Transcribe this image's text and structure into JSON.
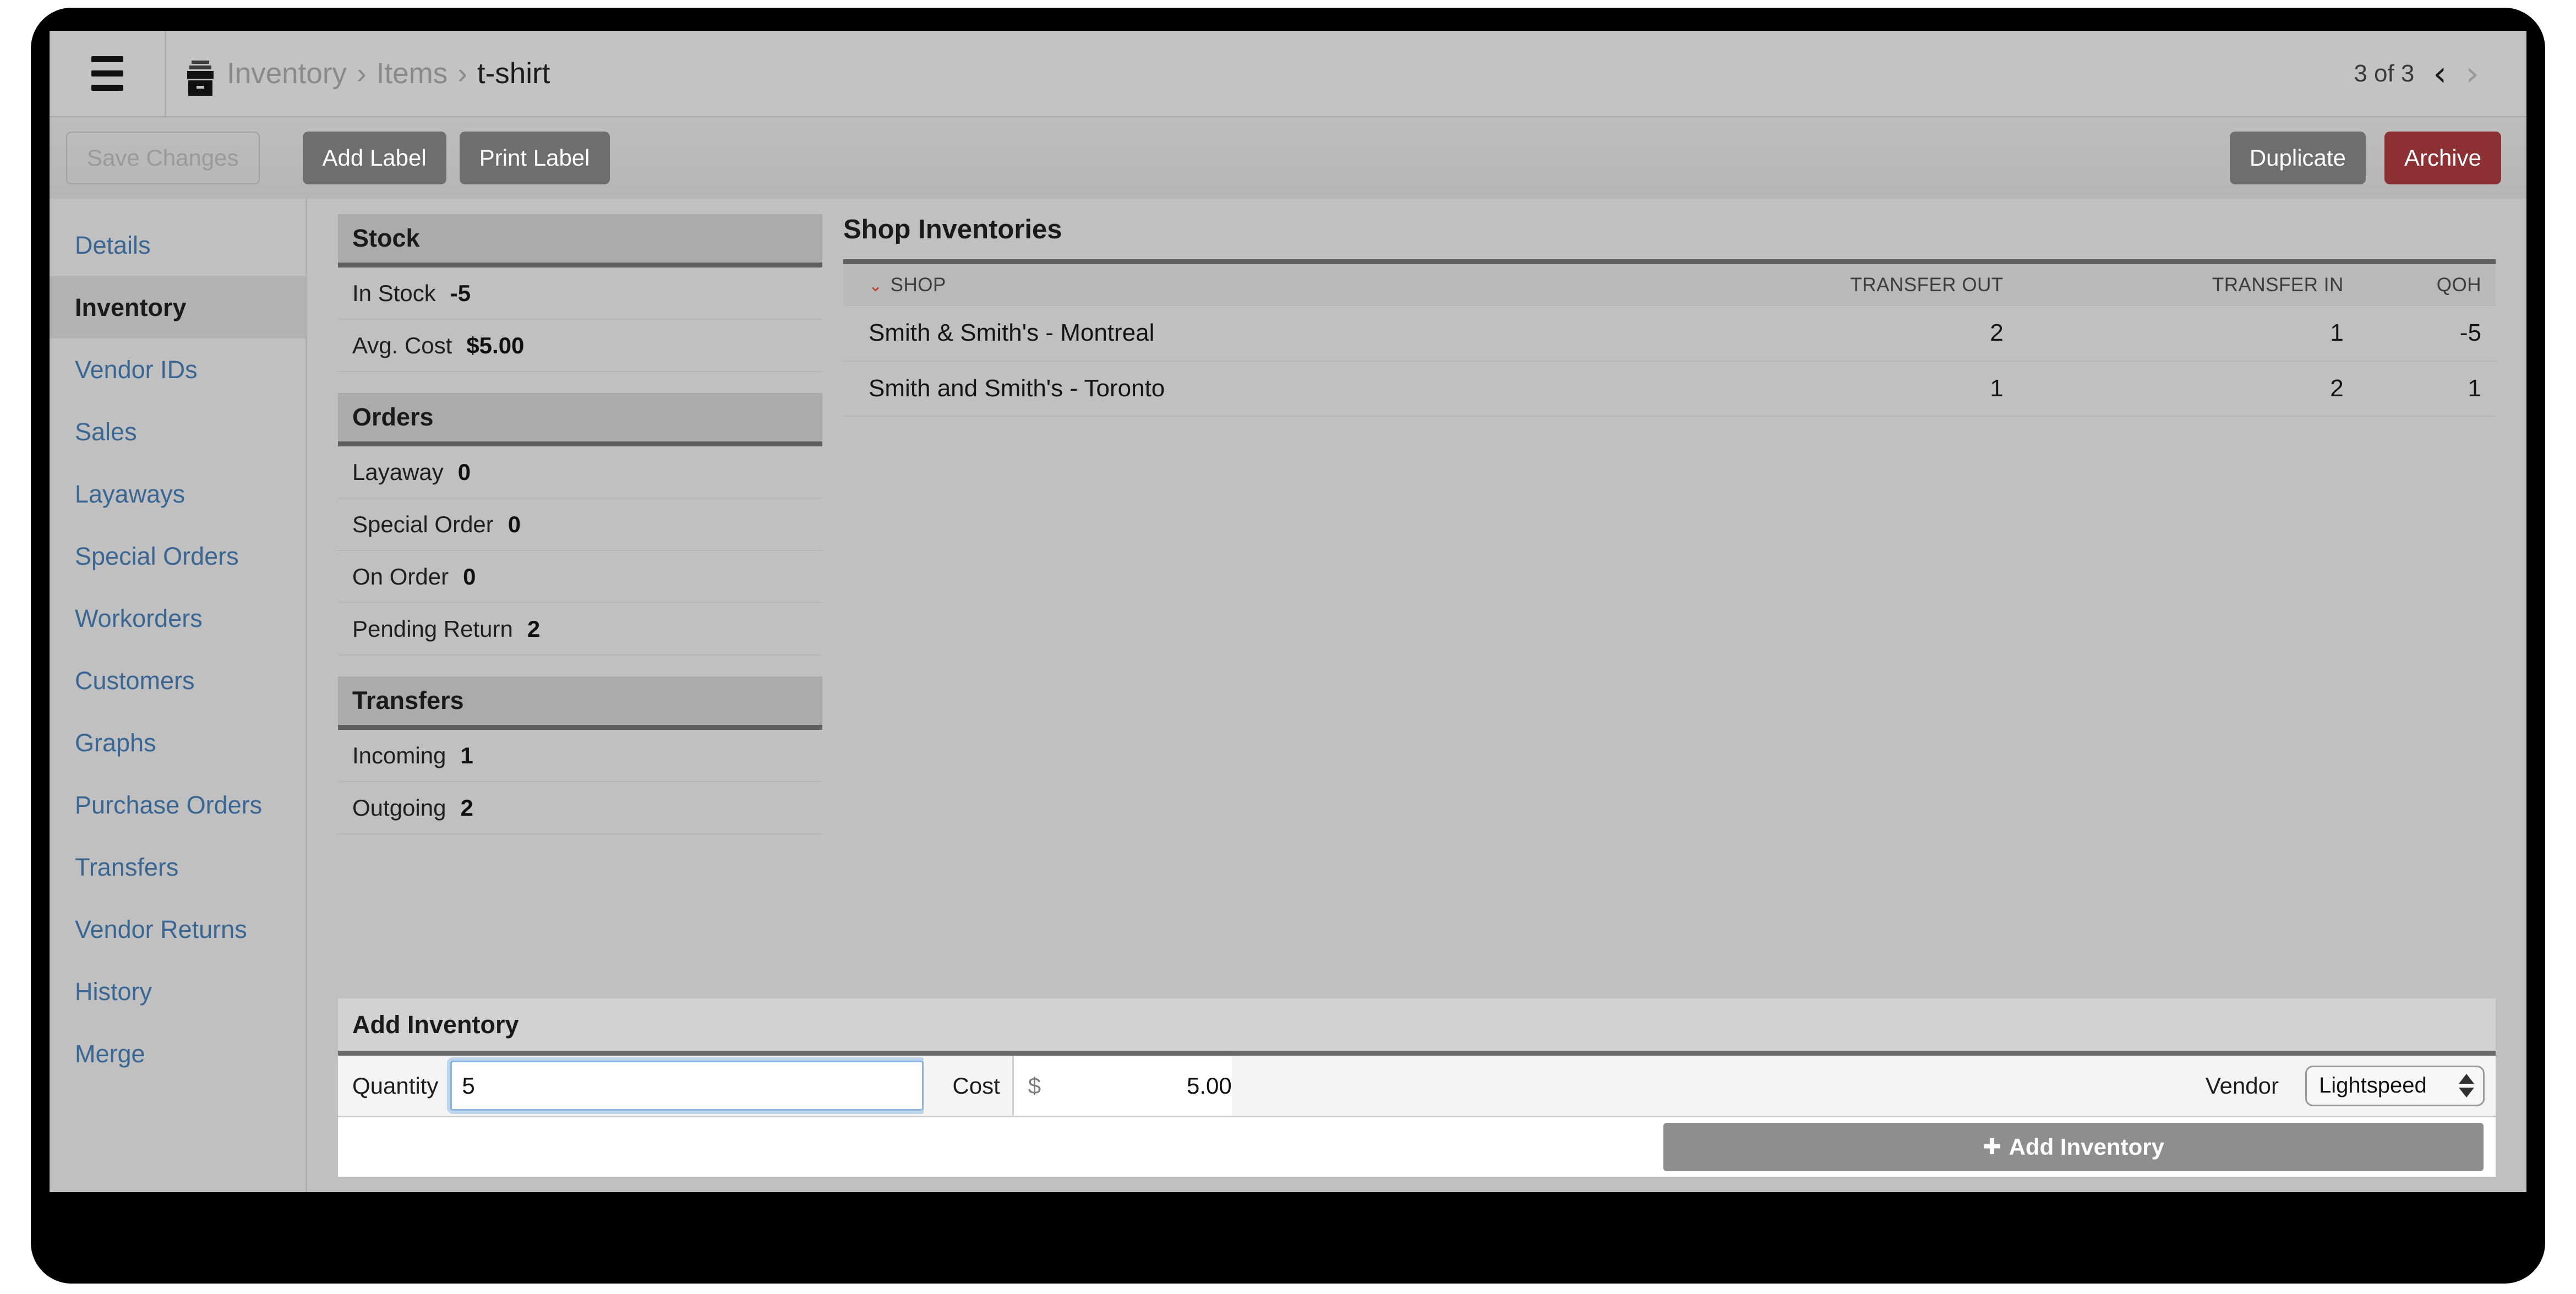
{
  "titlebar": {
    "menu_icon": "hamburger-icon",
    "breadcrumb_icon": "archive-box-icon",
    "breadcrumb": [
      {
        "label": "Inventory",
        "current": false
      },
      {
        "label": "Items",
        "current": false
      },
      {
        "label": "t-shirt",
        "current": true
      }
    ],
    "separator": "›",
    "pager": {
      "count_label": "3 of 3",
      "prev_glyph": "‹",
      "next_glyph": "›"
    }
  },
  "toolbar": {
    "save_changes_label": "Save Changes",
    "add_label_label": "Add Label",
    "print_label_label": "Print Label",
    "duplicate_label": "Duplicate",
    "archive_label": "Archive",
    "archive_color": "#8c3034",
    "button_color": "#6e6e6e"
  },
  "sidebar": {
    "items": [
      {
        "label": "Details",
        "active": false
      },
      {
        "label": "Inventory",
        "active": true
      },
      {
        "label": "Vendor IDs",
        "active": false
      },
      {
        "label": "Sales",
        "active": false
      },
      {
        "label": "Layaways",
        "active": false
      },
      {
        "label": "Special Orders",
        "active": false
      },
      {
        "label": "Workorders",
        "active": false
      },
      {
        "label": "Customers",
        "active": false
      },
      {
        "label": "Graphs",
        "active": false
      },
      {
        "label": "Purchase Orders",
        "active": false
      },
      {
        "label": "Transfers",
        "active": false
      },
      {
        "label": "Vendor Returns",
        "active": false
      },
      {
        "label": "History",
        "active": false
      },
      {
        "label": "Merge",
        "active": false
      }
    ],
    "link_color": "#3a6694"
  },
  "panels": [
    {
      "title": "Stock",
      "rows": [
        {
          "label": "In Stock",
          "value": "-5"
        },
        {
          "label": "Avg. Cost",
          "value": "$5.00"
        }
      ]
    },
    {
      "title": "Orders",
      "rows": [
        {
          "label": "Layaway",
          "value": "0"
        },
        {
          "label": "Special Order",
          "value": "0"
        },
        {
          "label": "On Order",
          "value": "0"
        },
        {
          "label": "Pending Return",
          "value": "2"
        }
      ]
    },
    {
      "title": "Transfers",
      "rows": [
        {
          "label": "Incoming",
          "value": "1"
        },
        {
          "label": "Outgoing",
          "value": "2"
        }
      ]
    }
  ],
  "shop_inventories": {
    "title": "Shop Inventories",
    "sort_caret": "⌄",
    "sort_caret_color": "#c0392b",
    "columns": [
      "SHOP",
      "TRANSFER OUT",
      "TRANSFER IN",
      "QOH"
    ],
    "rows": [
      {
        "shop": "Smith & Smith's - Montreal",
        "transfer_out": "2",
        "transfer_in": "1",
        "qoh": "-5"
      },
      {
        "shop": "Smith and Smith's - Toronto",
        "transfer_out": "1",
        "transfer_in": "2",
        "qoh": "1"
      }
    ]
  },
  "add_inventory": {
    "title": "Add Inventory",
    "quantity_label": "Quantity",
    "quantity_value": "5",
    "quantity_placeholder": "",
    "cost_label": "Cost",
    "cost_symbol": "$",
    "cost_value": "5.00",
    "vendor_label": "Vendor",
    "vendor_selected": "Lightspeed",
    "submit_label": "Add Inventory",
    "submit_icon": "✚"
  }
}
